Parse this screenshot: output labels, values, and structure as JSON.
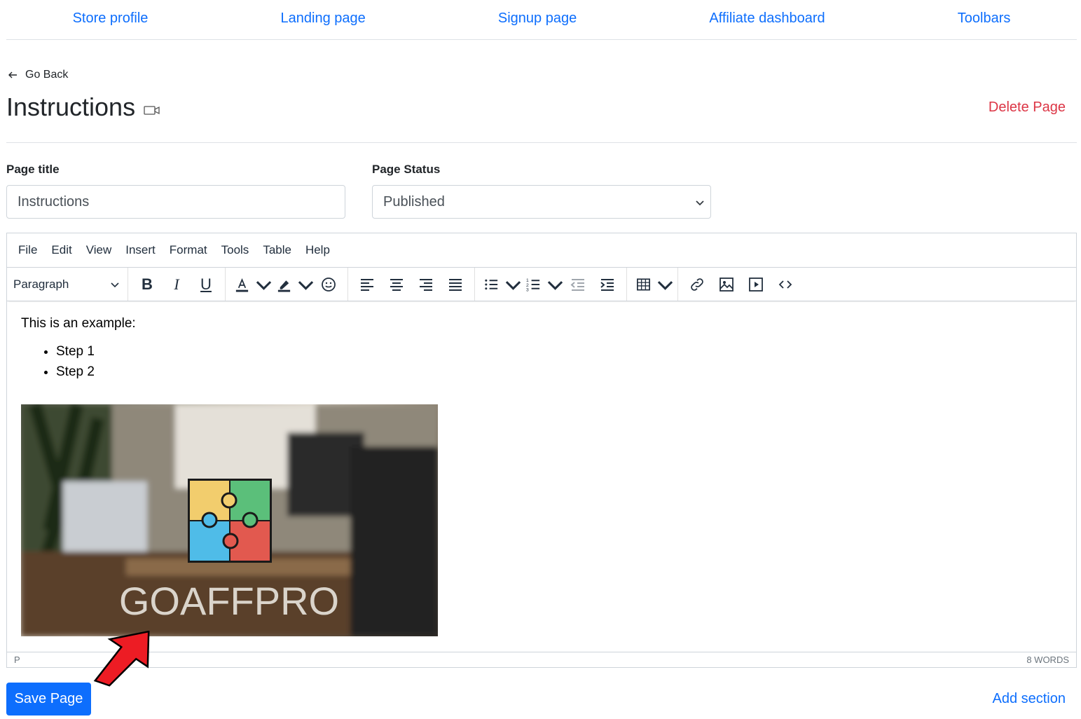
{
  "topnav": {
    "items": [
      "Store profile",
      "Landing page",
      "Signup page",
      "Affiliate dashboard",
      "Toolbars"
    ]
  },
  "goback": {
    "label": "Go Back",
    "icon": "arrow-left-icon"
  },
  "header": {
    "title": "Instructions",
    "title_icon": "video-camera-icon",
    "delete_label": "Delete Page"
  },
  "form": {
    "page_title_label": "Page title",
    "page_title_value": "Instructions",
    "status_label": "Page Status",
    "status_value": "Published"
  },
  "editor": {
    "menu": [
      "File",
      "Edit",
      "View",
      "Insert",
      "Format",
      "Tools",
      "Table",
      "Help"
    ],
    "block_format": "Paragraph",
    "content": {
      "intro": "This is an example:",
      "list": [
        "Step 1",
        "Step 2"
      ],
      "image_logo_text": "GOAFFPRO"
    },
    "status_path": "P",
    "word_count": "8 WORDS"
  },
  "footer": {
    "save_label": "Save Page",
    "add_section_label": "Add section"
  },
  "colors": {
    "primary": "#0d6efd",
    "danger": "#dc3545",
    "annotation_arrow": "#ed1c24"
  }
}
